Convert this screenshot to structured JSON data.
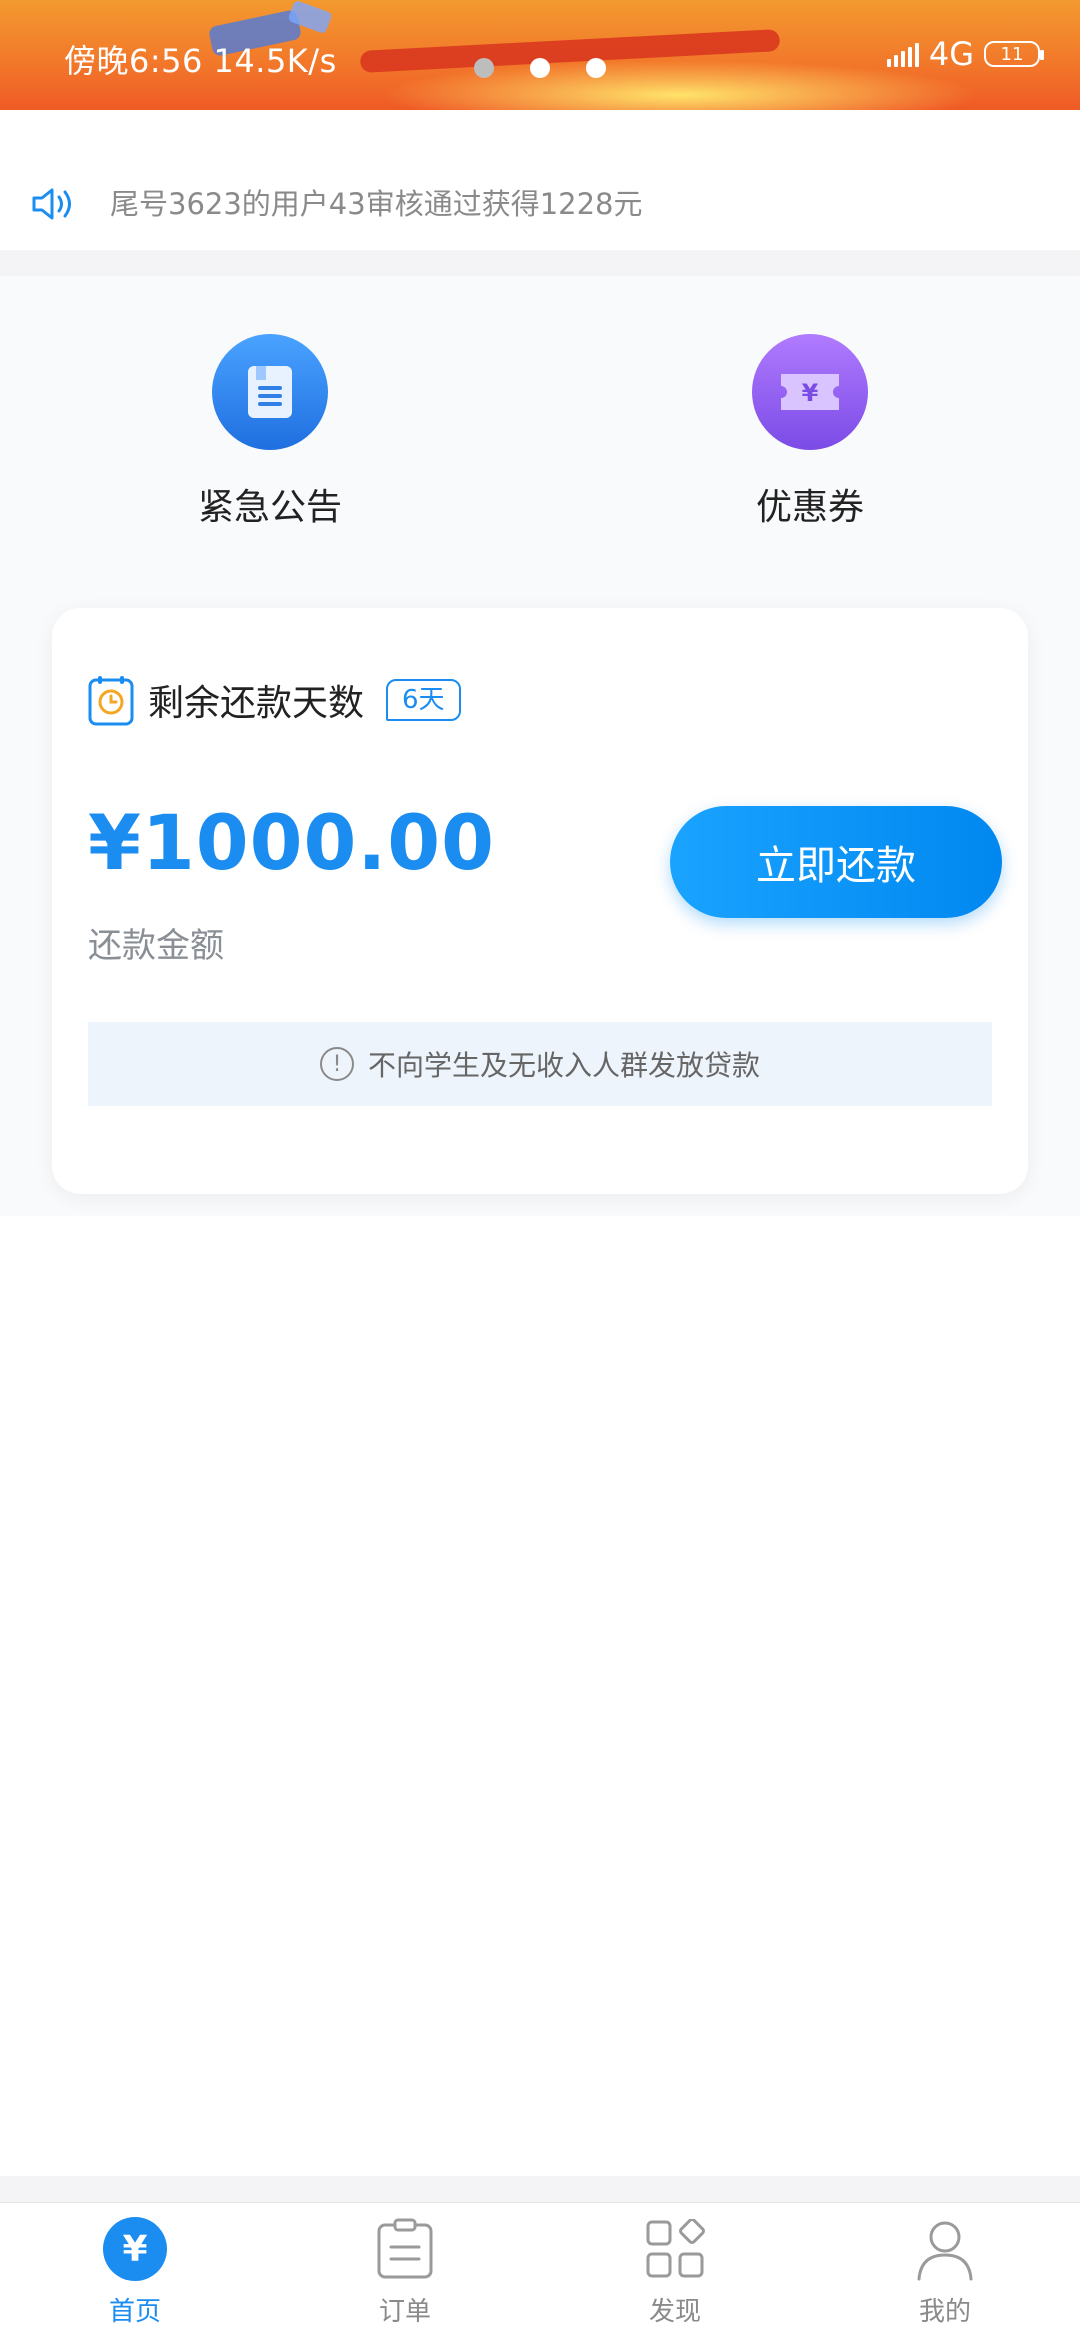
{
  "status_bar": {
    "time": "傍晚6:56",
    "speed": "14.5K/s",
    "network": "4G",
    "battery": "11"
  },
  "notice": {
    "text": "尾号3623的用户43审核通过获得1228元"
  },
  "shortcuts": {
    "announcement": "紧急公告",
    "coupon": "优惠券"
  },
  "repayment": {
    "title": "剩余还款天数",
    "days_badge": "6天",
    "amount": "¥1000.00",
    "amount_label": "还款金额",
    "button": "立即还款",
    "tip": "不向学生及无收入人群发放贷款"
  },
  "bottom_nav": {
    "home": "首页",
    "orders": "订单",
    "discover": "发现",
    "mine": "我的"
  },
  "colors": {
    "primary": "#1b8cf0",
    "banner_orange": "#f2762a"
  }
}
